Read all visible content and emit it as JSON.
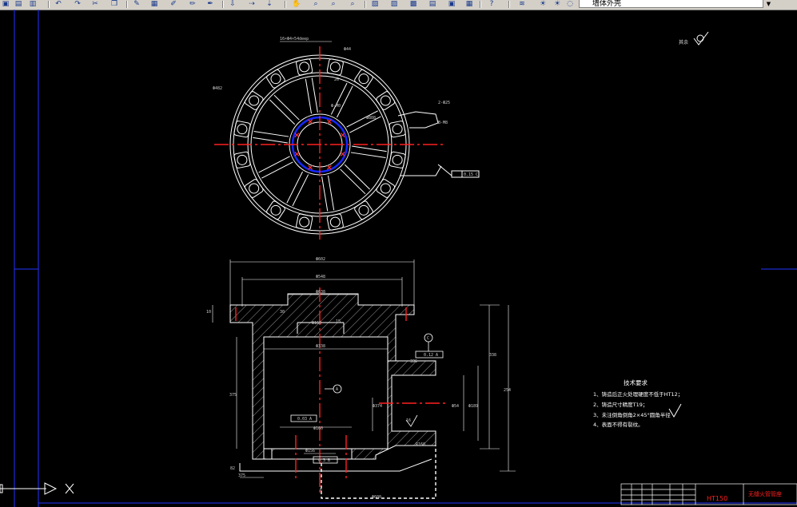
{
  "toolbar": {
    "layer_name": "墙体外壳",
    "icons": [
      "open-icon",
      "save-icon",
      "undo-icon",
      "redo-icon",
      "cut-icon",
      "copy-icon",
      "paste-icon",
      "match-icon",
      "pan-icon",
      "zoom-icon",
      "zoom-window-icon",
      "zoom-prev-icon",
      "properties-icon",
      "design-center-icon",
      "tool-palette-icon",
      "help-icon",
      "layer-manager-icon",
      "layer-state-icon"
    ]
  },
  "drawing": {
    "top_view": {
      "dims": [
        "16×Ф4×54deep",
        "Ф44",
        "Ф482",
        "26",
        "Ф-M0",
        "Ф888",
        "2-Ф25",
        "B-M8"
      ],
      "datum_frame": "0.15 C"
    },
    "section_view": {
      "dims": [
        "Ф602",
        "Ф548",
        "Ф638",
        "30",
        "Ф160",
        "Ф338",
        "15",
        "10",
        "375",
        "254",
        "338",
        "Ф374",
        "Ф54",
        "Ф160",
        "Ф189",
        "R160",
        "336",
        "Ф156",
        "16",
        "82",
        "375",
        "6",
        "Ф600"
      ],
      "datum_a": "A",
      "datum_c": "C",
      "tol_1": "0.12 A",
      "tol_2": "0.03 A",
      "tol_3": "0.3 B"
    },
    "roughness_note": "其余",
    "tech_req": {
      "title": "技术要求",
      "items": [
        "1、铸造后正火处理硬度不低于HT12；",
        "2、铸造尺寸精度T19；",
        "3、未注倒角倒角2×45°圆角半径",
        "4、表面不得有裂纹。"
      ]
    },
    "title_block": {
      "material": "HT150",
      "name": "无缝火管管座"
    }
  },
  "colors": {
    "background": "#000000",
    "lines": "#ffffff",
    "centerline": "#ff0000",
    "blue": "#1428ff",
    "frame": "#2233ff"
  }
}
